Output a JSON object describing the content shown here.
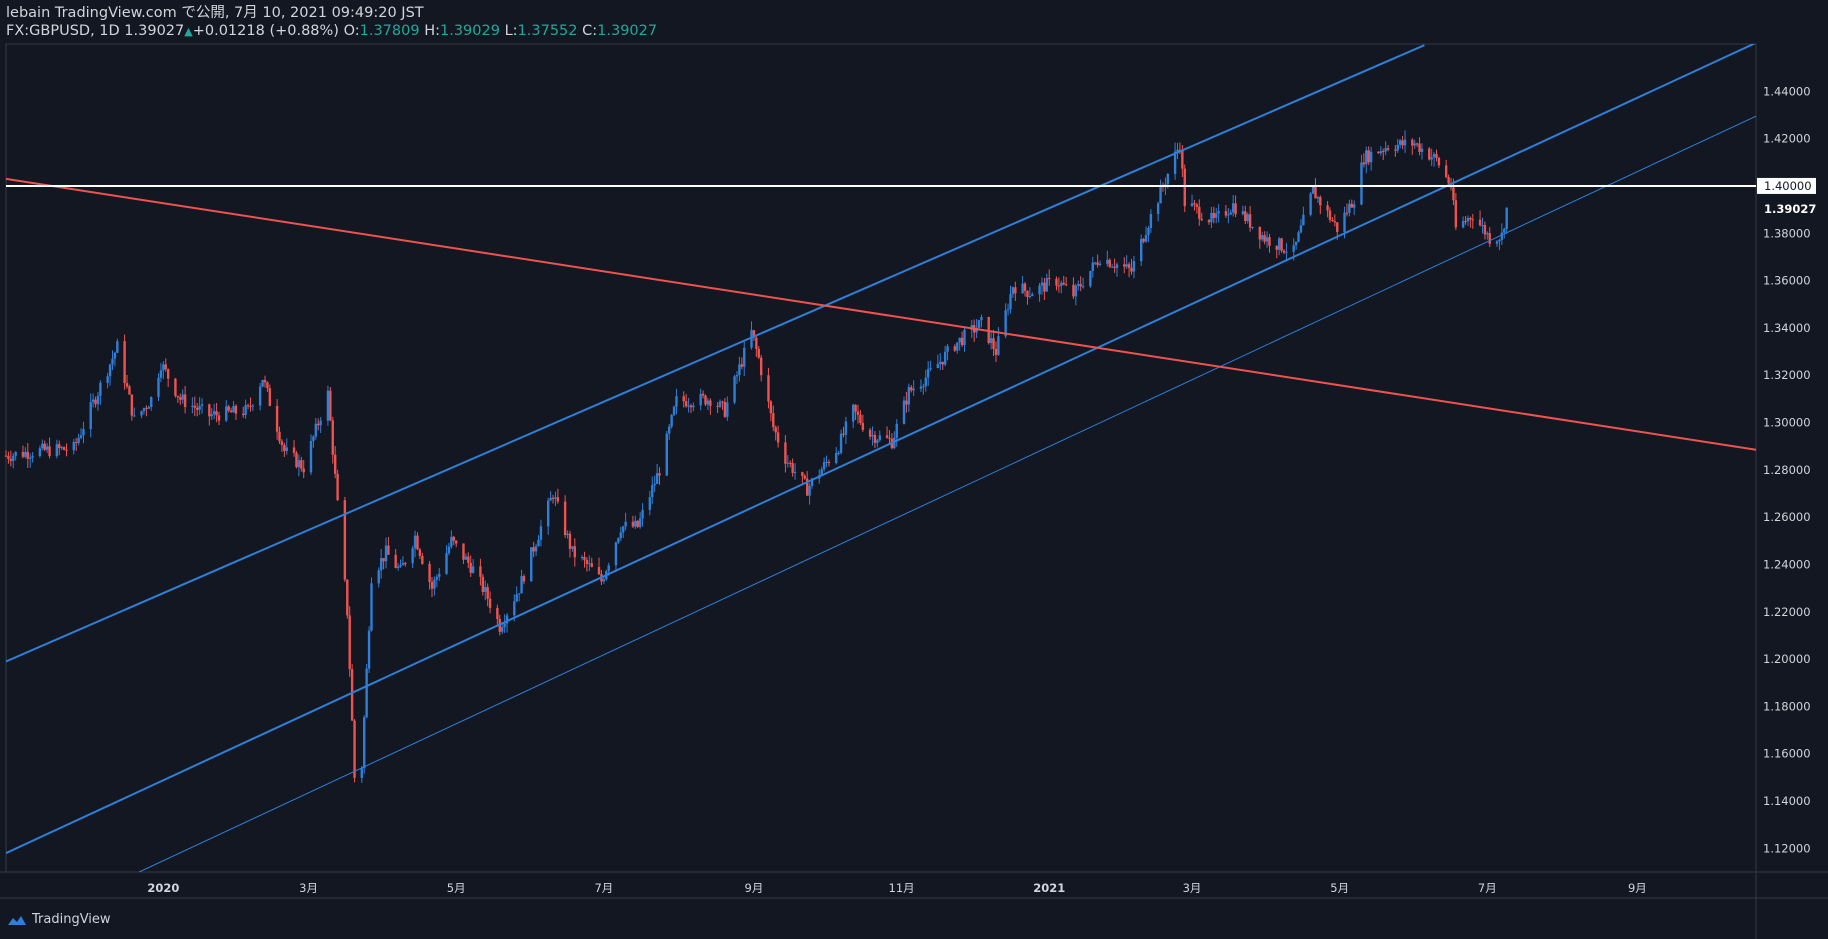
{
  "header": {
    "line1": "lebain TradingView.com で公開, 7月 10, 2021 09:49:20 JST",
    "symbol_text": "FX:GBPUSD, 1D 1.39027",
    "change_arrow": "▲",
    "change_text": "+0.01218 (+0.88%)",
    "o_label": "O:",
    "o_value": "1.37809",
    "h_label": "H:",
    "h_value": "1.39029",
    "l_label": "L:",
    "l_value": "1.37552",
    "c_label": "C:",
    "c_value": "1.39027"
  },
  "footer": {
    "brand": "TradingView",
    "logo_icon": "tradingview-logo-icon"
  },
  "colors": {
    "background": "#131722",
    "up": "#2f7fd8",
    "down": "#ef5350",
    "channel": "#2f7fd8",
    "trend": "#ef5350",
    "level": "#ffffff",
    "axis_text": "#d1d4dc"
  },
  "chart_data": {
    "type": "candlestick",
    "symbol": "FX:GBPUSD",
    "timeframe": "1D",
    "ylim": [
      1.11,
      1.46
    ],
    "y_ticks": [
      "1.44000",
      "1.42000",
      "1.40000",
      "1.38000",
      "1.36000",
      "1.34000",
      "1.32000",
      "1.30000",
      "1.28000",
      "1.26000",
      "1.24000",
      "1.22000",
      "1.20000",
      "1.18000",
      "1.16000",
      "1.14000",
      "1.12000"
    ],
    "x_ticks": [
      {
        "label": "2020",
        "date": "2020-01-01"
      },
      {
        "label": "3月",
        "date": "2020-03-01"
      },
      {
        "label": "5月",
        "date": "2020-05-01"
      },
      {
        "label": "7月",
        "date": "2020-07-01"
      },
      {
        "label": "9月",
        "date": "2020-09-01"
      },
      {
        "label": "11月",
        "date": "2020-11-01"
      },
      {
        "label": "2021",
        "date": "2021-01-01"
      },
      {
        "label": "3月",
        "date": "2021-03-01"
      },
      {
        "label": "5月",
        "date": "2021-05-01"
      },
      {
        "label": "7月",
        "date": "2021-07-01"
      },
      {
        "label": "9月",
        "date": "2021-09-01"
      }
    ],
    "x_start": "2019-10-28",
    "x_end": "2021-10-20",
    "level_label": "1.40000",
    "level_value": 1.4,
    "last_price_label": "1.39027",
    "last_price": 1.39027,
    "grid": false,
    "path": [
      [
        "2019-10-28",
        1.286
      ],
      [
        "2019-11-10",
        1.288
      ],
      [
        "2019-11-25",
        1.289
      ],
      [
        "2019-12-05",
        1.313
      ],
      [
        "2019-12-13",
        1.332
      ],
      [
        "2019-12-20",
        1.301
      ],
      [
        "2019-12-27",
        1.31
      ],
      [
        "2019-12-31",
        1.325
      ],
      [
        "2020-01-08",
        1.31
      ],
      [
        "2020-01-20",
        1.303
      ],
      [
        "2020-02-05",
        1.305
      ],
      [
        "2020-02-11",
        1.319
      ],
      [
        "2020-02-20",
        1.288
      ],
      [
        "2020-02-28",
        1.281
      ],
      [
        "2020-03-06",
        1.303
      ],
      [
        "2020-03-09",
        1.312
      ],
      [
        "2020-03-13",
        1.265
      ],
      [
        "2020-03-17",
        1.22
      ],
      [
        "2020-03-20",
        1.15
      ],
      [
        "2020-03-23",
        1.155
      ],
      [
        "2020-03-27",
        1.235
      ],
      [
        "2020-04-02",
        1.245
      ],
      [
        "2020-04-08",
        1.237
      ],
      [
        "2020-04-14",
        1.252
      ],
      [
        "2020-04-21",
        1.23
      ],
      [
        "2020-04-29",
        1.25
      ],
      [
        "2020-05-08",
        1.238
      ],
      [
        "2020-05-14",
        1.226
      ],
      [
        "2020-05-19",
        1.214
      ],
      [
        "2020-05-27",
        1.23
      ],
      [
        "2020-06-10",
        1.27
      ],
      [
        "2020-06-18",
        1.245
      ],
      [
        "2020-06-25",
        1.239
      ],
      [
        "2020-06-30",
        1.233
      ],
      [
        "2020-07-08",
        1.256
      ],
      [
        "2020-07-15",
        1.256
      ],
      [
        "2020-07-24",
        1.28
      ],
      [
        "2020-07-31",
        1.309
      ],
      [
        "2020-08-14",
        1.31
      ],
      [
        "2020-08-20",
        1.305
      ],
      [
        "2020-08-31",
        1.338
      ],
      [
        "2020-09-03",
        1.327
      ],
      [
        "2020-09-09",
        1.298
      ],
      [
        "2020-09-14",
        1.285
      ],
      [
        "2020-09-23",
        1.272
      ],
      [
        "2020-10-06",
        1.29
      ],
      [
        "2020-10-12",
        1.305
      ],
      [
        "2020-10-19",
        1.295
      ],
      [
        "2020-10-28",
        1.292
      ],
      [
        "2020-11-04",
        1.313
      ],
      [
        "2020-11-12",
        1.32
      ],
      [
        "2020-11-23",
        1.333
      ],
      [
        "2020-12-04",
        1.342
      ],
      [
        "2020-12-10",
        1.33
      ],
      [
        "2020-12-17",
        1.358
      ],
      [
        "2020-12-24",
        1.355
      ],
      [
        "2021-01-04",
        1.36
      ],
      [
        "2021-01-11",
        1.354
      ],
      [
        "2021-01-22",
        1.37
      ],
      [
        "2021-02-04",
        1.364
      ],
      [
        "2021-02-10",
        1.382
      ],
      [
        "2021-02-24",
        1.418
      ],
      [
        "2021-02-26",
        1.393
      ],
      [
        "2021-03-10",
        1.385
      ],
      [
        "2021-03-18",
        1.392
      ],
      [
        "2021-03-31",
        1.378
      ],
      [
        "2021-04-12",
        1.372
      ],
      [
        "2021-04-20",
        1.398
      ],
      [
        "2021-04-30",
        1.382
      ],
      [
        "2021-05-07",
        1.395
      ],
      [
        "2021-05-11",
        1.412
      ],
      [
        "2021-05-21",
        1.417
      ],
      [
        "2021-06-01",
        1.418
      ],
      [
        "2021-06-10",
        1.411
      ],
      [
        "2021-06-16",
        1.4
      ],
      [
        "2021-06-18",
        1.382
      ],
      [
        "2021-06-25",
        1.388
      ],
      [
        "2021-07-02",
        1.378
      ],
      [
        "2021-07-07",
        1.379
      ],
      [
        "2021-07-09",
        1.3903
      ]
    ],
    "lines": [
      {
        "name": "upper-channel",
        "color": "#2f7fd8",
        "width": 2,
        "p1": [
          "2019-10-28",
          1.199
        ],
        "p2": [
          "2021-06-05",
          1.4595
        ]
      },
      {
        "name": "middle-channel",
        "color": "#2f7fd8",
        "width": 2,
        "p1": [
          "2019-10-28",
          1.118
        ],
        "p2": [
          "2021-10-20",
          1.4605
        ]
      },
      {
        "name": "lower-channel",
        "color": "#2f7fd8",
        "width": 1,
        "p1": [
          "2019-12-22",
          1.11
        ],
        "p2": [
          "2021-10-20",
          1.4295
        ]
      },
      {
        "name": "red-trendline",
        "color": "#ef5350",
        "width": 2,
        "p1": [
          "2019-10-28",
          1.403
        ],
        "p2": [
          "2021-10-20",
          1.2885
        ]
      },
      {
        "name": "resistance-level",
        "color": "#ffffff",
        "width": 2,
        "p1": [
          "2019-10-28",
          1.4
        ],
        "p2": [
          "2021-10-20",
          1.4
        ]
      }
    ]
  }
}
